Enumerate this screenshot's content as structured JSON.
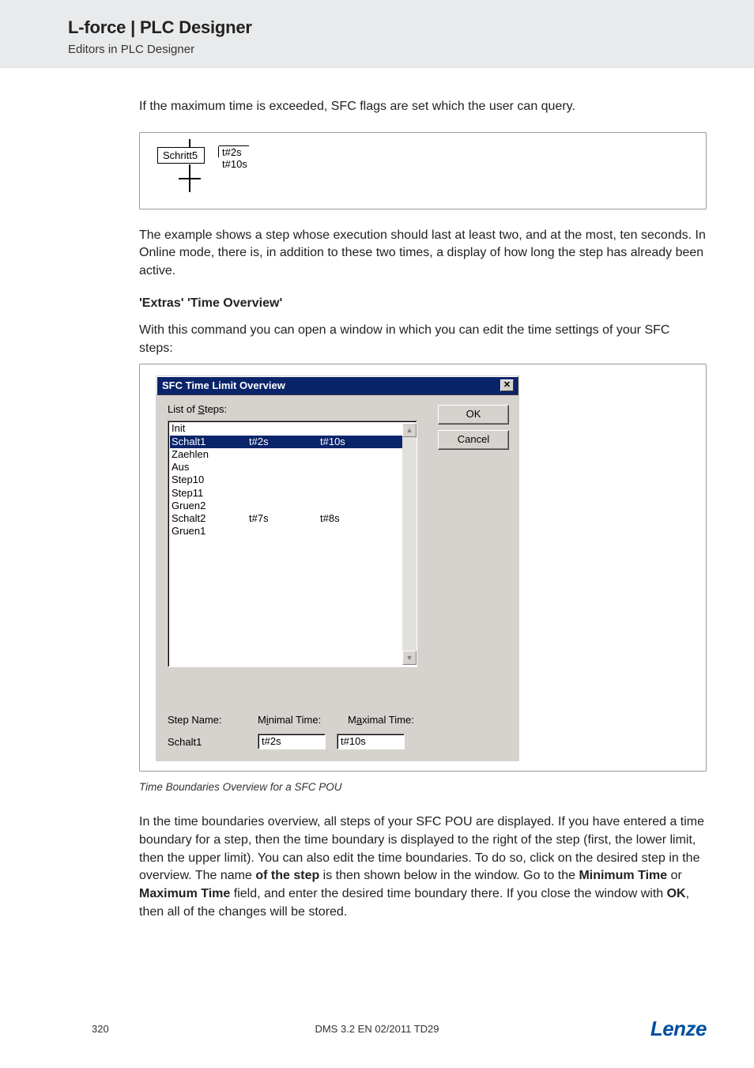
{
  "header": {
    "title": "L-force | PLC Designer",
    "subtitle": "Editors in PLC Designer"
  },
  "text": {
    "p1": "If the maximum time is exceeded, SFC flags are set which the user can query.",
    "sfc_step": {
      "name": "Schritt5",
      "t1": "t#2s",
      "t2": "t#10s"
    },
    "p2": "The example shows a step whose execution should last at least two, and at the most, ten seconds. In Online mode, there is, in addition to these two times, a display of how long the step has already been active.",
    "subheading": "'Extras' 'Time Overview'",
    "p3": "With this command you can open a window in which you can edit the time settings of your SFC steps:",
    "dialog": {
      "title": "SFC Time Limit Overview",
      "list_label_pre": "List of ",
      "list_label_u": "S",
      "list_label_post": "teps:",
      "ok": "OK",
      "cancel": "Cancel",
      "steps": [
        {
          "name": "Init",
          "min": "",
          "max": ""
        },
        {
          "name": "Schalt1",
          "min": "t#2s",
          "max": "t#10s",
          "selected": true
        },
        {
          "name": "Zaehlen",
          "min": "",
          "max": ""
        },
        {
          "name": "Aus",
          "min": "",
          "max": ""
        },
        {
          "name": "Step10",
          "min": "",
          "max": ""
        },
        {
          "name": "Step11",
          "min": "",
          "max": ""
        },
        {
          "name": "Gruen2",
          "min": "",
          "max": ""
        },
        {
          "name": "Schalt2",
          "min": "t#7s",
          "max": "t#8s"
        },
        {
          "name": "Gruen1",
          "min": "",
          "max": ""
        }
      ],
      "step_name_lbl": "Step Name:",
      "min_lbl_pre": "M",
      "min_lbl_u": "i",
      "min_lbl_post": "nimal Time:",
      "max_lbl_pre": "M",
      "max_lbl_u": "a",
      "max_lbl_post": "ximal Time:",
      "step_name_val": "Schalt1",
      "min_val": "t#2s",
      "max_val": "t#10s"
    },
    "caption": "Time Boundaries Overview for a SFC POU",
    "p4_pre": "In the time boundaries overview, all steps of your SFC POU are displayed. If you have entered a time boundary for a step, then the time boundary is displayed to the right of the step (first, the lower limit, then the upper limit). You can also edit the time boundaries. To do so, click on the desired step in the overview. The name ",
    "p4_b1": "of the step",
    "p4_mid1": " is then shown below in the window. Go to the ",
    "p4_b2": "Minimum Time",
    "p4_mid2": " or ",
    "p4_b3": "Maximum Time",
    "p4_mid3": " field, and enter the desired time boundary there. If you close the window with ",
    "p4_b4": "OK",
    "p4_end": ", then all of the changes will be stored."
  },
  "footer": {
    "page": "320",
    "center": "DMS 3.2 EN 02/2011 TD29",
    "logo": "Lenze"
  }
}
